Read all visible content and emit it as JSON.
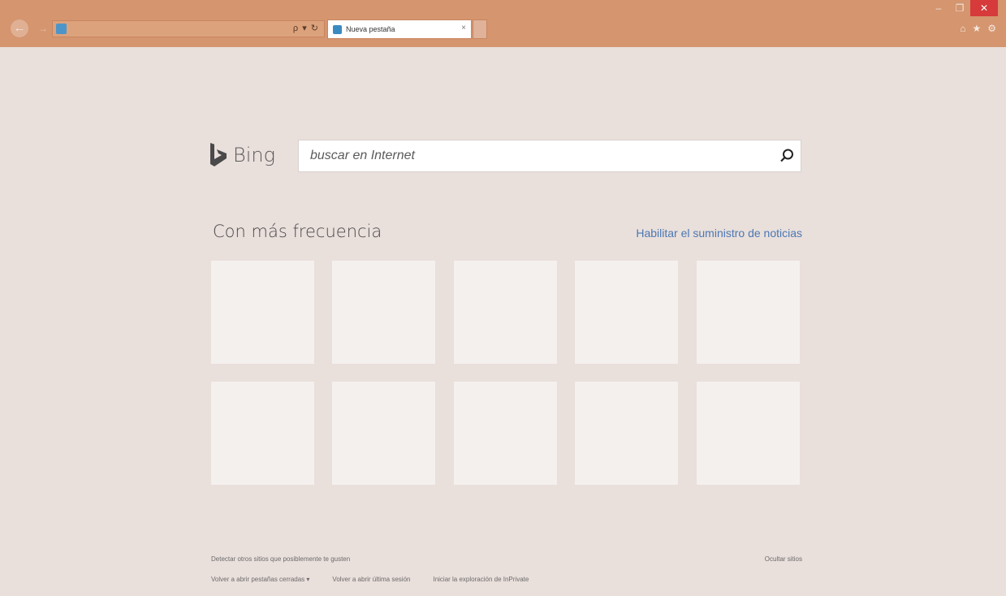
{
  "browser": {
    "back_icon": "back-arrow-icon",
    "forward_icon": "forward-arrow-icon",
    "address_controls": "ρ ▾ ↻",
    "tab_title": "Nueva pestaña",
    "tab_close": "×",
    "window": {
      "minimize": "–",
      "restore": "❐",
      "close": "✕"
    },
    "toolbar": {
      "home": "⌂",
      "favorites": "★",
      "settings": "⚙"
    },
    "chrome_color": "#d4956f"
  },
  "bing": {
    "brand": "Bing",
    "placeholder": "buscar en Internet"
  },
  "frequent": {
    "title": "Con más frecuencia",
    "news_link": "Habilitar el suministro de noticias"
  },
  "footer": {
    "discover": "Detectar otros sitios que posiblemente te gusten",
    "hide_sites": "Ocultar sitios",
    "reopen_tabs": "Volver a abrir pestañas cerradas ▾",
    "reopen_session": "Volver a abrir última sesión",
    "inprivate": "Iniciar la exploración de InPrivate"
  }
}
